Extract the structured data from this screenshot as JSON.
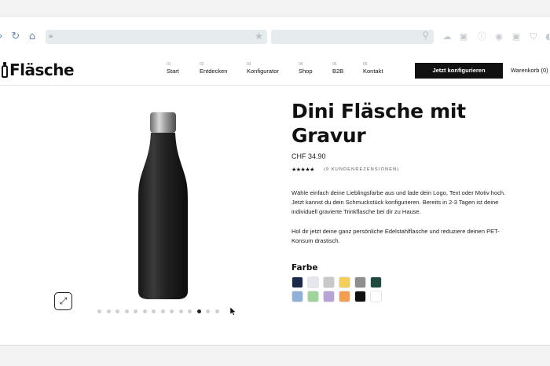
{
  "browser": {
    "url": "",
    "search": ""
  },
  "site": {
    "logo": "Fläsche",
    "nav": [
      {
        "num": "01",
        "label": "Start"
      },
      {
        "num": "02",
        "label": "Entdecken"
      },
      {
        "num": "03",
        "label": "Konfigurator"
      },
      {
        "num": "04",
        "label": "Shop"
      },
      {
        "num": "05",
        "label": "B2B"
      },
      {
        "num": "06",
        "label": "Kontakt"
      }
    ],
    "cta": "Jetzt konfigurieren",
    "cart": "Warenkorb (0)"
  },
  "product": {
    "title": "Dini Fläsche mit Gravur",
    "price": "CHF 34.90",
    "stars": "★★★★★",
    "reviews": "(9 KUNDENREZENSIONEN)",
    "description_1": "Wähle einfach deine Lieblingsfarbe aus und lade dein Logo, Text oder Motiv hoch. Jetzt kannst du dein Schmuckstück konfigurieren. Bereits in 2-3 Tagen ist deine individuell gravierte Trinkflasche bei dir zu Hause.",
    "description_2": "Hol dir jetzt deine ganz persönliche Edelstahlflasche und reduziere deinen PET-Konsum drastisch.",
    "color_label": "Farbe",
    "colors": [
      "#1b2a4a",
      "#e6e6ee",
      "#c9c9c9",
      "#f3cf5a",
      "#8e8e8e",
      "#1f4a40",
      "#8fb0d8",
      "#9fd49a",
      "#b7a4d6",
      "#f2a04f",
      "#111111",
      "#ffffff"
    ]
  },
  "gallery": {
    "dot_count": 14,
    "active_dot": 11
  }
}
